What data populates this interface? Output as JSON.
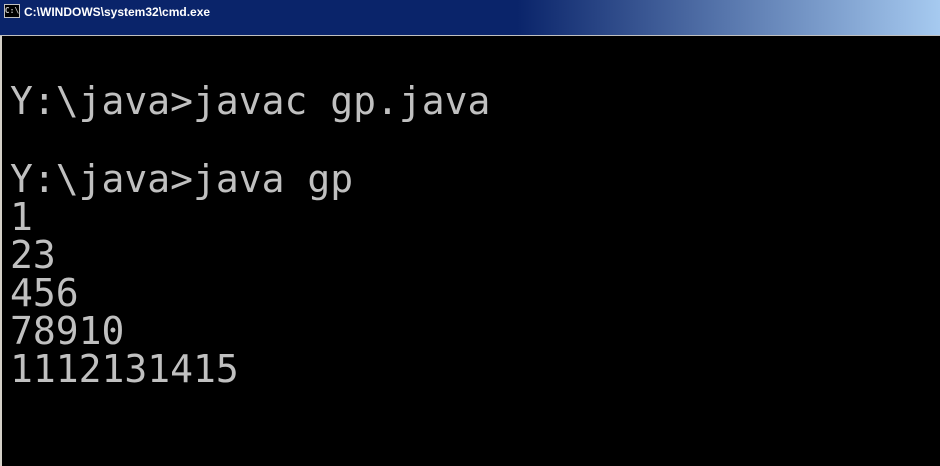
{
  "window": {
    "title": "C:\\WINDOWS\\system32\\cmd.exe",
    "icon": "cmd-icon",
    "icon_glyph": "C:\\"
  },
  "console": {
    "lines": [
      "Y:\\java>javac gp.java",
      "",
      "Y:\\java>java gp",
      "1",
      "23",
      "456",
      "78910",
      "1112131415"
    ]
  },
  "colors": {
    "background": "#000000",
    "text": "#c0c0c0",
    "titlebar": "#0a246a"
  }
}
